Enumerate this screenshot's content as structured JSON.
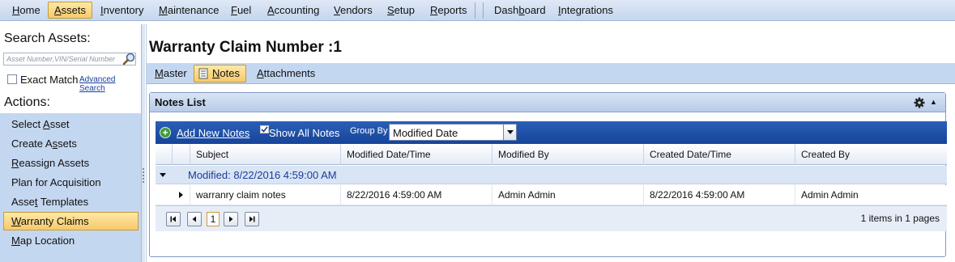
{
  "menu": {
    "items": [
      {
        "label": "Home",
        "underline": "H",
        "rest": "ome"
      },
      {
        "label": "Assets",
        "underline": "A",
        "rest": "ssets",
        "active": true
      },
      {
        "label": "Inventory",
        "underline": "I",
        "rest": "nventory"
      },
      {
        "label": "Maintenance",
        "underline": "M",
        "rest": "aintenance"
      },
      {
        "label": "Fuel",
        "underline": "F",
        "rest": "uel"
      },
      {
        "label": "Accounting",
        "underline": "A",
        "rest": "ccounting"
      },
      {
        "label": "Vendors",
        "underline": "V",
        "rest": "endors"
      },
      {
        "label": "Setup",
        "underline": "S",
        "rest": "etup"
      },
      {
        "label": "Reports",
        "underline": "R",
        "rest": "eports"
      },
      {
        "label": "Dashboard",
        "underline": "b",
        "rest": ""
      },
      {
        "label": "Integrations",
        "underline": "I",
        "rest": "ntegrations"
      }
    ]
  },
  "left": {
    "search_heading": "Search Assets:",
    "search_placeholder": "Asset Number,VIN/Serial Number",
    "exact_match_label": "Exact Match",
    "advanced_search_label": "Advanced Search",
    "actions_heading": "Actions:",
    "actions": [
      {
        "pre": "Select ",
        "u": "A",
        "post": "sset"
      },
      {
        "pre": "Create A",
        "u": "s",
        "post": "sets"
      },
      {
        "pre": "",
        "u": "R",
        "post": "eassign Assets"
      },
      {
        "pre": "Plan for Acquisition",
        "u": "",
        "post": ""
      },
      {
        "pre": "Asse",
        "u": "t",
        "post": " Templates"
      },
      {
        "pre": "",
        "u": "W",
        "post": "arranty Claims",
        "active": true
      },
      {
        "pre": "",
        "u": "M",
        "post": "ap Location"
      }
    ]
  },
  "main": {
    "title": "Warranty Claim Number :1",
    "tabs": [
      {
        "u": "M",
        "post": "aster"
      },
      {
        "u": "N",
        "post": "otes",
        "active": true
      },
      {
        "u": "A",
        "post": "ttachments"
      }
    ],
    "notes_list_title": "Notes List",
    "add_new_notes_label": "Add New Notes",
    "show_all_notes_label": "Show All Notes",
    "group_by_label": "Group By",
    "group_by_value": "Modified Date",
    "columns": [
      "Subject",
      "Modified Date/Time",
      "Modified By",
      "Created Date/Time",
      "Created By"
    ],
    "group_label": "Modified: 8/22/2016 4:59:00 AM",
    "rows": [
      {
        "subject": "warranry claim notes",
        "modified_datetime": "8/22/2016 4:59:00 AM",
        "modified_by": "Admin Admin",
        "created_datetime": "8/22/2016 4:59:00 AM",
        "created_by": "Admin Admin"
      }
    ],
    "pager": {
      "current_page": "1",
      "info": "1 items in 1 pages"
    }
  },
  "colors": {
    "menu_bg": "#c6d6ee",
    "active_bg": "#f7c96a",
    "toolbar_bg": "#1e53aa",
    "group_row_bg": "#d9e4f4",
    "link_blue": "#1a3d9a"
  }
}
